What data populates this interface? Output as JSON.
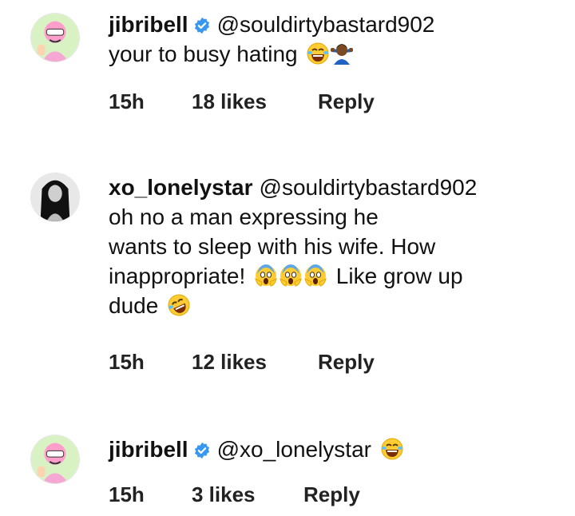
{
  "comments": [
    {
      "username": "jibribell",
      "mention": "@souldirtybastard902",
      "lines": [
        "your to busy hating"
      ],
      "time": "15h",
      "likes": "18 likes",
      "reply": "Reply"
    },
    {
      "username": "xo_lonelystar",
      "mention": "@souldirtybastard902",
      "lines": [
        "oh no a man expressing he",
        "wants to sleep with his wife. How",
        "inappropriate!",
        "Like grow up",
        "dude"
      ],
      "time": "15h",
      "likes": "12 likes",
      "reply": "Reply"
    },
    {
      "username": "jibribell",
      "mention": "@xo_lonelystar",
      "lines": [],
      "time": "15h",
      "likes": "3 likes",
      "reply": "Reply"
    }
  ],
  "icons": {
    "verified": "verified-badge-icon",
    "emoji_laugh": "tears-of-joy-emoji",
    "emoji_shrug": "person-shrugging-emoji",
    "emoji_scream": "face-screaming-emoji",
    "emoji_rofl": "rolling-on-floor-laughing-emoji"
  },
  "colors": {
    "verified": "#3897f0",
    "text": "#111111",
    "meta": "#222222"
  }
}
